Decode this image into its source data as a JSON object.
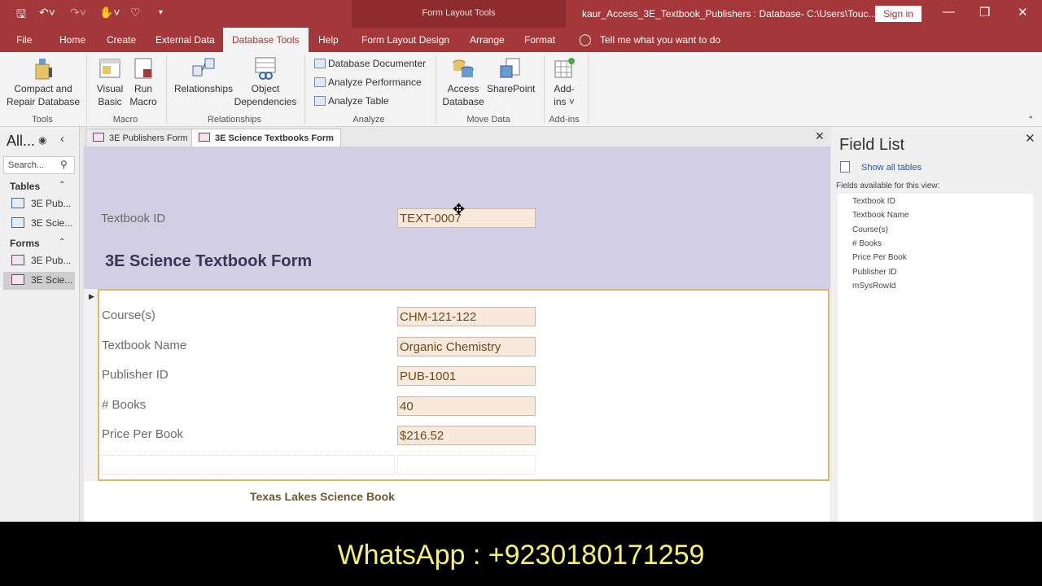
{
  "titlebar": {
    "context_label": "Form Layout Tools",
    "doc_title": "kaur_Access_3E_Textbook_Publishers : Database- C:\\Users\\Touc...",
    "signin": "Sign in",
    "qat_icons": [
      "save-icon",
      "undo-icon",
      "redo-icon",
      "touch-mode-icon",
      "customize-icon"
    ],
    "window_icons": [
      "minimize-icon",
      "restore-icon",
      "close-icon"
    ]
  },
  "tabs": [
    "File",
    "Home",
    "Create",
    "External Data",
    "Database Tools",
    "Help",
    "Form Layout Design",
    "Arrange",
    "Format"
  ],
  "active_tab": "Database Tools",
  "tellme": "Tell me what you want to do",
  "ribbon": {
    "groups": {
      "tools": "Tools",
      "macro": "Macro",
      "relationships": "Relationships",
      "analyze": "Analyze",
      "move_data": "Move Data",
      "addins": "Add-ins"
    },
    "buttons": {
      "compact_line1": "Compact and",
      "compact_line2": "Repair Database",
      "vb_line1": "Visual",
      "vb_line2": "Basic",
      "run_line1": "Run",
      "run_line2": "Macro",
      "relationships": "Relationships",
      "objdep_line1": "Object",
      "objdep_line2": "Dependencies",
      "documenter": "Database Documenter",
      "perf": "Analyze Performance",
      "table": "Analyze Table",
      "access_line1": "Access",
      "access_line2": "Database",
      "sharepoint": "SharePoint",
      "addins_line1": "Add-",
      "addins_line2": "ins ˅"
    }
  },
  "nav": {
    "title": "All...",
    "search_placeholder": "Search...",
    "tables_header": "Tables",
    "forms_header": "Forms",
    "tables": [
      "3E Pub...",
      "3E Scie..."
    ],
    "forms": [
      "3E Pub...",
      "3E Scie..."
    ]
  },
  "doc": {
    "tabs": [
      "3E Publishers Form",
      "3E Science Textbooks Form"
    ],
    "active_tab": "3E Science Textbooks Form",
    "header": {
      "id_label": "Textbook ID",
      "id_value": "TEXT-0007",
      "title": "3E Science Textbook Form"
    },
    "fields": [
      {
        "label": "Course(s)",
        "value": "CHM-121-122"
      },
      {
        "label": "Textbook Name",
        "value": "Organic Chemistry"
      },
      {
        "label": "Publisher ID",
        "value": "PUB-1001"
      },
      {
        "label": "# Books",
        "value": "40"
      },
      {
        "label": "Price Per Book",
        "value": "$216.52"
      }
    ],
    "footer": "Texas Lakes Science Book"
  },
  "fieldlist": {
    "title": "Field List",
    "show_all": "Show all tables",
    "available": "Fields available for this view:",
    "fields": [
      "Textbook ID",
      "Textbook Name",
      "Course(s)",
      "# Books",
      "Price Per Book",
      "Publisher ID",
      "mSysRowId"
    ]
  },
  "watermark": "WhatsApp : +9230180171259"
}
